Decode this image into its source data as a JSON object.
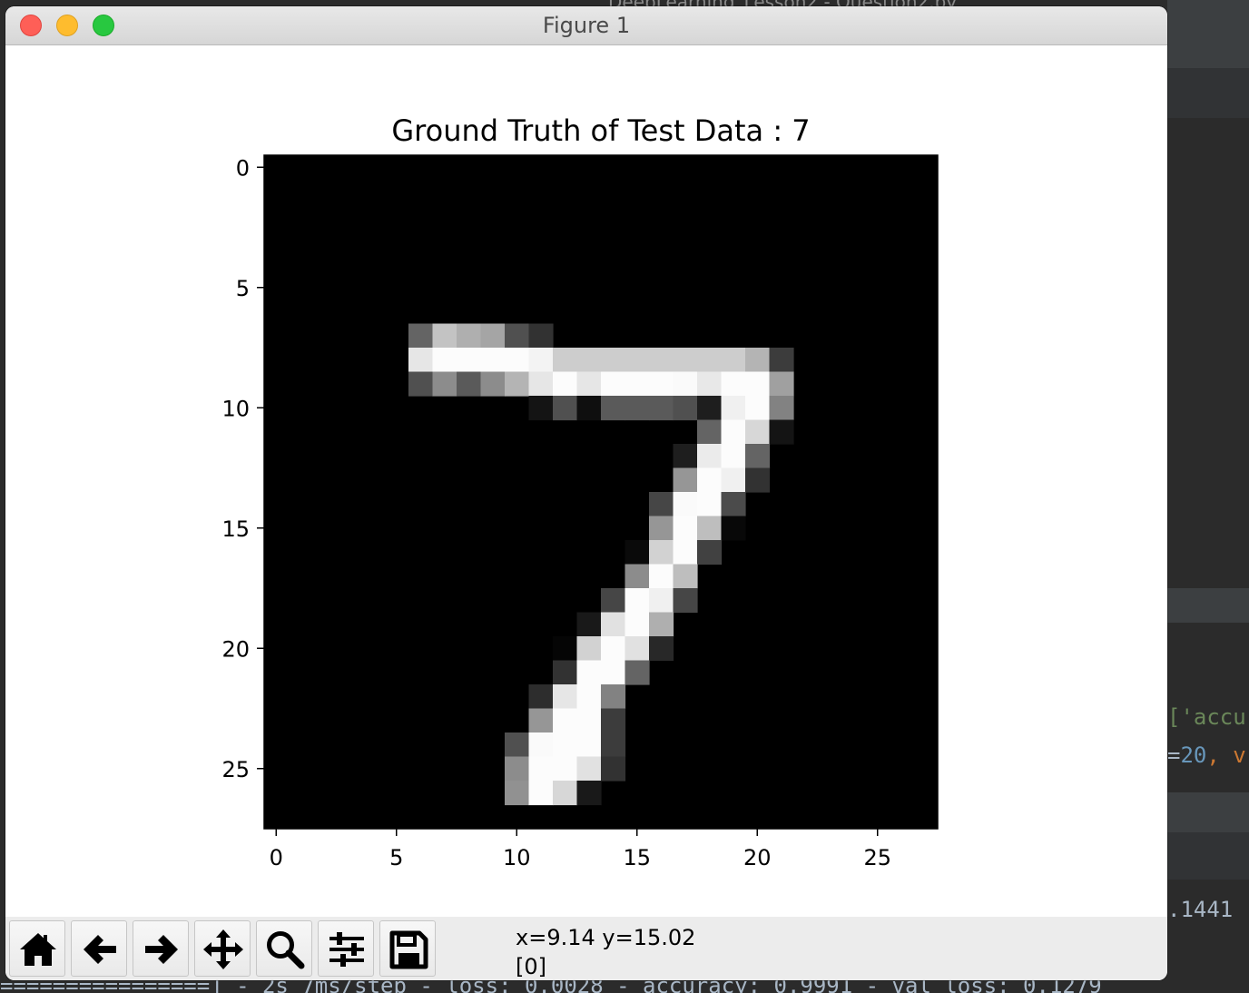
{
  "window": {
    "title": "Figure 1"
  },
  "background_ide": {
    "behind_title": "DeepLearning_Lesson2 - Question2.py",
    "code_fragment_1": "['accu",
    "code_fragment_2_prefix": "=",
    "code_fragment_2_number": "20",
    "code_fragment_2_suffix": ", v",
    "log_fragment": ".1441",
    "bottom_log": "================] - 2s 7ms/step - loss: 0.0028 - accuracy: 0.9991 - val_loss: 0.1279",
    "colors": {
      "bg": "#2b2b2b",
      "band": "#3c3f41",
      "string": "#6a8759",
      "number": "#6897bb",
      "keyword": "#cc7832",
      "text": "#a9b7c6"
    }
  },
  "toolbar": {
    "buttons": [
      {
        "name": "home-button",
        "icon": "home-icon"
      },
      {
        "name": "back-button",
        "icon": "arrow-left-icon"
      },
      {
        "name": "forward-button",
        "icon": "arrow-right-icon"
      },
      {
        "name": "pan-button",
        "icon": "move-icon"
      },
      {
        "name": "zoom-button",
        "icon": "magnifier-icon"
      },
      {
        "name": "configure-subplots-button",
        "icon": "sliders-icon"
      },
      {
        "name": "save-button",
        "icon": "floppy-disk-icon"
      }
    ],
    "coordinate_readout": "x=9.14 y=15.02\n[0]"
  },
  "chart_data": {
    "type": "heatmap",
    "title": "Ground Truth of Test Data : 7",
    "colormap": "gray",
    "shape": [
      28,
      28
    ],
    "xlim": [
      -0.5,
      27.5
    ],
    "ylim": [
      27.5,
      -0.5
    ],
    "xticks": [
      0,
      5,
      10,
      15,
      20,
      25
    ],
    "yticks": [
      0,
      5,
      10,
      15,
      20,
      25
    ],
    "xtick_labels": [
      "0",
      "5",
      "10",
      "15",
      "20",
      "25"
    ],
    "ytick_labels": [
      "0",
      "5",
      "10",
      "15",
      "20",
      "25"
    ],
    "background_value": 0,
    "nonzero_pixels": [
      [
        7,
        6,
        100
      ],
      [
        7,
        7,
        195
      ],
      [
        7,
        8,
        175
      ],
      [
        7,
        9,
        165
      ],
      [
        7,
        10,
        80
      ],
      [
        7,
        11,
        50
      ],
      [
        8,
        6,
        230
      ],
      [
        8,
        7,
        252
      ],
      [
        8,
        8,
        252
      ],
      [
        8,
        9,
        252
      ],
      [
        8,
        10,
        252
      ],
      [
        8,
        11,
        243
      ],
      [
        8,
        12,
        205
      ],
      [
        8,
        13,
        205
      ],
      [
        8,
        14,
        205
      ],
      [
        8,
        15,
        205
      ],
      [
        8,
        16,
        205
      ],
      [
        8,
        17,
        205
      ],
      [
        8,
        18,
        205
      ],
      [
        8,
        19,
        205
      ],
      [
        8,
        20,
        180
      ],
      [
        8,
        21,
        60
      ],
      [
        9,
        6,
        80
      ],
      [
        9,
        7,
        140
      ],
      [
        9,
        8,
        90
      ],
      [
        9,
        9,
        140
      ],
      [
        9,
        10,
        180
      ],
      [
        9,
        11,
        230
      ],
      [
        9,
        12,
        252
      ],
      [
        9,
        13,
        230
      ],
      [
        9,
        14,
        252
      ],
      [
        9,
        15,
        252
      ],
      [
        9,
        16,
        252
      ],
      [
        9,
        17,
        250
      ],
      [
        9,
        18,
        232
      ],
      [
        9,
        19,
        252
      ],
      [
        9,
        20,
        252
      ],
      [
        9,
        21,
        160
      ],
      [
        10,
        11,
        20
      ],
      [
        10,
        12,
        80
      ],
      [
        10,
        13,
        15
      ],
      [
        10,
        14,
        90
      ],
      [
        10,
        15,
        90
      ],
      [
        10,
        16,
        90
      ],
      [
        10,
        17,
        80
      ],
      [
        10,
        18,
        30
      ],
      [
        10,
        19,
        240
      ],
      [
        10,
        20,
        252
      ],
      [
        10,
        21,
        130
      ],
      [
        11,
        18,
        100
      ],
      [
        11,
        19,
        252
      ],
      [
        11,
        20,
        215
      ],
      [
        11,
        21,
        20
      ],
      [
        12,
        17,
        30
      ],
      [
        12,
        18,
        235
      ],
      [
        12,
        19,
        252
      ],
      [
        12,
        20,
        100
      ],
      [
        13,
        17,
        150
      ],
      [
        13,
        18,
        252
      ],
      [
        13,
        19,
        240
      ],
      [
        13,
        20,
        50
      ],
      [
        14,
        16,
        70
      ],
      [
        14,
        17,
        250
      ],
      [
        14,
        18,
        252
      ],
      [
        14,
        19,
        75
      ],
      [
        15,
        16,
        150
      ],
      [
        15,
        17,
        252
      ],
      [
        15,
        18,
        190
      ],
      [
        15,
        19,
        8
      ],
      [
        16,
        15,
        10
      ],
      [
        16,
        16,
        210
      ],
      [
        16,
        17,
        252
      ],
      [
        16,
        18,
        65
      ],
      [
        17,
        15,
        140
      ],
      [
        17,
        16,
        252
      ],
      [
        17,
        17,
        190
      ],
      [
        18,
        14,
        70
      ],
      [
        18,
        15,
        252
      ],
      [
        18,
        16,
        240
      ],
      [
        18,
        17,
        70
      ],
      [
        19,
        13,
        25
      ],
      [
        19,
        14,
        225
      ],
      [
        19,
        15,
        252
      ],
      [
        19,
        16,
        175
      ],
      [
        20,
        12,
        5
      ],
      [
        20,
        13,
        210
      ],
      [
        20,
        14,
        252
      ],
      [
        20,
        15,
        225
      ],
      [
        20,
        16,
        40
      ],
      [
        21,
        12,
        50
      ],
      [
        21,
        13,
        252
      ],
      [
        21,
        14,
        252
      ],
      [
        21,
        15,
        100
      ],
      [
        22,
        11,
        45
      ],
      [
        22,
        12,
        230
      ],
      [
        22,
        13,
        252
      ],
      [
        22,
        14,
        130
      ],
      [
        23,
        11,
        150
      ],
      [
        23,
        12,
        252
      ],
      [
        23,
        13,
        252
      ],
      [
        23,
        14,
        60
      ],
      [
        24,
        10,
        80
      ],
      [
        24,
        11,
        250
      ],
      [
        24,
        12,
        252
      ],
      [
        24,
        13,
        252
      ],
      [
        24,
        14,
        60
      ],
      [
        25,
        10,
        140
      ],
      [
        25,
        11,
        252
      ],
      [
        25,
        12,
        252
      ],
      [
        25,
        13,
        225
      ],
      [
        25,
        14,
        50
      ],
      [
        26,
        10,
        145
      ],
      [
        26,
        11,
        252
      ],
      [
        26,
        12,
        215
      ],
      [
        26,
        13,
        25
      ]
    ]
  }
}
